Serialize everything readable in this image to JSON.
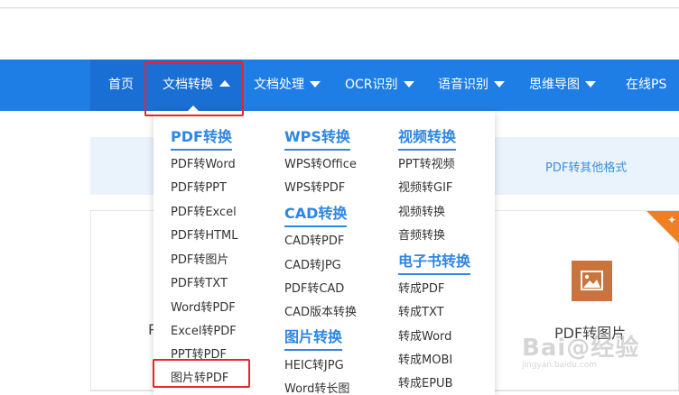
{
  "nav": {
    "items": [
      {
        "label": "首页"
      },
      {
        "label": "文档转换"
      },
      {
        "label": "文档处理"
      },
      {
        "label": "OCR识别"
      },
      {
        "label": "语音识别"
      },
      {
        "label": "思维导图"
      },
      {
        "label": "在线PS"
      }
    ]
  },
  "banner": {
    "text": "PDF转其他格式"
  },
  "card": {
    "left_title": "P",
    "title": "PDF转图片",
    "corner_icon": "flame-icon",
    "image_icon": "image-icon",
    "image_icon_color": "#c8743c"
  },
  "watermark": {
    "main": "Bai@经验",
    "sub": "jingyan.baidu.com"
  },
  "dropdown": {
    "col1": {
      "header": "PDF转换",
      "items": [
        "PDF转Word",
        "PDF转PPT",
        "PDF转Excel",
        "PDF转HTML",
        "PDF转图片",
        "PDF转TXT",
        "Word转PDF",
        "Excel转PDF",
        "PPT转PDF",
        "图片转PDF"
      ]
    },
    "col2": {
      "header": "WPS转换",
      "items": [
        "WPS转Office",
        "WPS转PDF"
      ],
      "header2": "CAD转换",
      "items2": [
        "CAD转PDF",
        "CAD转JPG",
        "PDF转CAD",
        "CAD版本转换"
      ],
      "header3": "图片转换",
      "items3": [
        "HEIC转JPG",
        "Word转长图"
      ]
    },
    "col3": {
      "header": "视频转换",
      "items": [
        "PPT转视频",
        "视频转GIF",
        "视频转换",
        "音频转换"
      ],
      "header2": "电子书转换",
      "items2": [
        "转成PDF",
        "转成TXT",
        "转成Word",
        "转成MOBI",
        "转成EPUB"
      ]
    }
  },
  "colors": {
    "nav_bg": "#1f7ee6",
    "nav_active": "#1a6fd4",
    "accent": "#2f86e3",
    "highlight": "#e8262a"
  }
}
